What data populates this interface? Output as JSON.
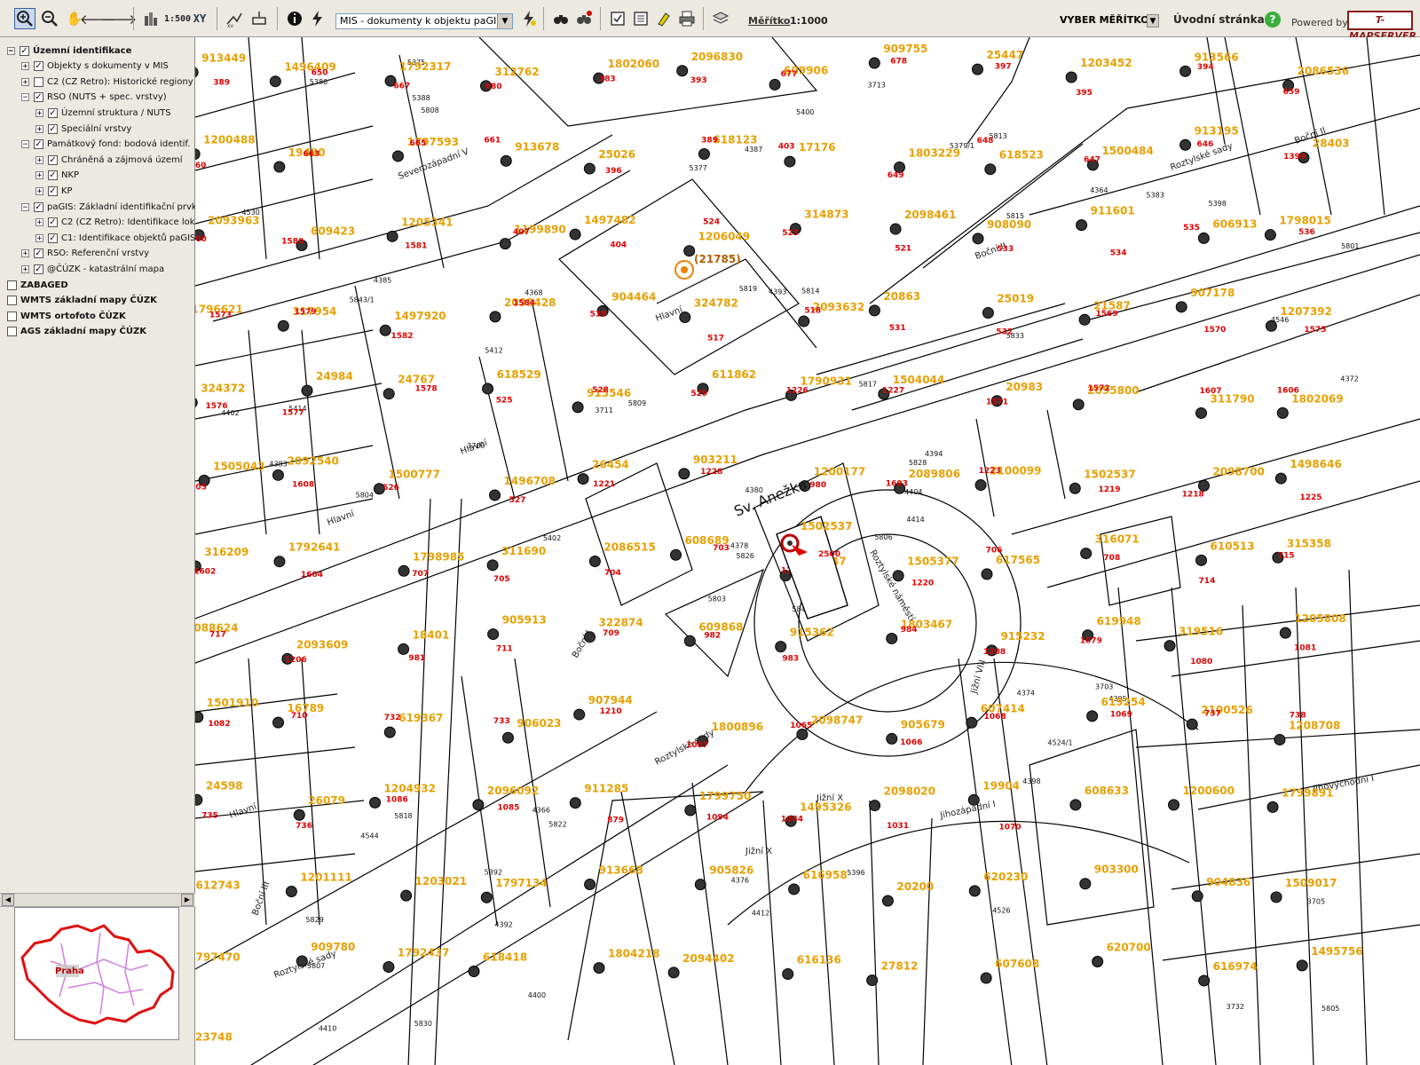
{
  "toolbar": {
    "zoom_scale_label": "1:500",
    "xy_label": "XY",
    "layer_select_value": "MIS - dokumenty k objektu paGIS",
    "scale_link_label": "Měřítko",
    "scale_value": "1:1000",
    "scale_select_value": "VYBER MĚŘÍTKO",
    "home_label": "Úvodní stránka",
    "help_label": "?",
    "powered_label": "Powered by",
    "logo_text": "T-MAPSERVER"
  },
  "layers": [
    {
      "label": "Územní identifikace",
      "checked": true,
      "bold": true,
      "level": 0,
      "expander": "−"
    },
    {
      "label": "Objekty s dokumenty v MIS",
      "checked": true,
      "bold": false,
      "level": 1,
      "expander": "+"
    },
    {
      "label": "C2 (CZ Retro): Historické regiony",
      "checked": false,
      "bold": false,
      "level": 1,
      "expander": "+"
    },
    {
      "label": "RSO (NUTS + spec. vrstvy)",
      "checked": true,
      "bold": false,
      "level": 1,
      "expander": "−"
    },
    {
      "label": "Územní struktura / NUTS",
      "checked": true,
      "bold": false,
      "level": 2,
      "expander": "+"
    },
    {
      "label": "Speciální vrstvy",
      "checked": true,
      "bold": false,
      "level": 2,
      "expander": "+"
    },
    {
      "label": "Památkový fond: bodová identif.",
      "checked": true,
      "bold": false,
      "level": 1,
      "expander": "−"
    },
    {
      "label": "Chráněná a zájmová území",
      "checked": true,
      "bold": false,
      "level": 2,
      "expander": "+"
    },
    {
      "label": "NKP",
      "checked": true,
      "bold": false,
      "level": 2,
      "expander": "+"
    },
    {
      "label": "KP",
      "checked": true,
      "bold": false,
      "level": 2,
      "expander": "+"
    },
    {
      "label": "paGIS: Základní identifikační prvky",
      "checked": true,
      "bold": false,
      "level": 1,
      "expander": "−"
    },
    {
      "label": "C2 (CZ Retro): Identifikace lokalit",
      "checked": true,
      "bold": false,
      "level": 2,
      "expander": "+"
    },
    {
      "label": "C1: Identifikace objektů paGIS",
      "checked": true,
      "bold": false,
      "level": 2,
      "expander": "+"
    },
    {
      "label": "RSO: Referenční vrstvy",
      "checked": true,
      "bold": false,
      "level": 1,
      "expander": "+"
    },
    {
      "label": "@ČÚZK - katastrální mapa",
      "checked": true,
      "bold": false,
      "level": 1,
      "expander": "+"
    },
    {
      "label": "ZABAGED",
      "checked": false,
      "bold": true,
      "level": 0,
      "expander": ""
    },
    {
      "label": "WMTS základní mapy ČÚZK",
      "checked": false,
      "bold": true,
      "level": 0,
      "expander": ""
    },
    {
      "label": "WMTS ortofoto ČÚZK",
      "checked": false,
      "bold": true,
      "level": 0,
      "expander": ""
    },
    {
      "label": "AGS základní mapy ČÚZK",
      "checked": false,
      "bold": true,
      "level": 0,
      "expander": ""
    }
  ],
  "overview": {
    "label": "Praha"
  },
  "map": {
    "church_label": "Sv. Anežka",
    "highlight_label": "(21785)",
    "selected_id": "1502537",
    "selected_red": "2500",
    "streets": [
      "Hlavní",
      "Boční I",
      "Boční II",
      "Roztylské sady",
      "Roztylské náměstí",
      "Jižní X",
      "Jižní VIII",
      "Jihovýchodní I",
      "Jihozápadní I",
      "Severozápadní V",
      "Boční III"
    ],
    "parcels": [
      "5843/2",
      "5843/1",
      "5826",
      "5829",
      "5828",
      "5822",
      "5813",
      "5814",
      "5815",
      "5806",
      "5808",
      "5805",
      "5804",
      "5801",
      "5803",
      "5833",
      "5830",
      "5819",
      "5817",
      "5818",
      "5809",
      "5807",
      "4392",
      "4393",
      "4394",
      "4395",
      "4385",
      "4387",
      "4383",
      "4374",
      "4372",
      "4378",
      "4376",
      "4380",
      "4368",
      "4364",
      "4366",
      "3732",
      "3705",
      "3703",
      "3713",
      "3711",
      "3709",
      "4398",
      "4400",
      "4402",
      "4404",
      "4410",
      "4412",
      "4414",
      "4544",
      "4546",
      "4530",
      "4524/1",
      "4526",
      "5392",
      "5388",
      "5386",
      "5396",
      "5398",
      "5400",
      "5402",
      "5414",
      "5412",
      "5383",
      "5375",
      "5379/1",
      "5377"
    ],
    "orange_labels": [
      "913449",
      "1496409",
      "1792317",
      "312762",
      "1802060",
      "2096830",
      "609906",
      "909755",
      "25447",
      "1203452",
      "913566",
      "2086536",
      "1200488",
      "19490",
      "1797593",
      "913678",
      "25026",
      "618123",
      "17176",
      "1803229",
      "618523",
      "1500484",
      "913195",
      "28403",
      "2093963",
      "609423",
      "1205341",
      "1199890",
      "1497482",
      "1206049",
      "314873",
      "2098461",
      "908090",
      "911601",
      "606913",
      "1798015",
      "1796621",
      "317954",
      "1497920",
      "2098428",
      "904464",
      "324782",
      "2093632",
      "20863",
      "25019",
      "21587",
      "907178",
      "1207392",
      "324372",
      "24984",
      "24767",
      "618529",
      "915546",
      "611862",
      "1790931",
      "1504044",
      "20983",
      "2095800",
      "311790",
      "1802069",
      "1505043",
      "2092540",
      "1500777",
      "1496708",
      "26454",
      "903211",
      "1200177",
      "2089806",
      "2100099",
      "1502537",
      "2098700",
      "1498646",
      "316209",
      "1792641",
      "1798985",
      "311690",
      "2086515",
      "608689",
      "2089747",
      "1505377",
      "617565",
      "316071",
      "610513",
      "315358",
      "2088624",
      "2093609",
      "18401",
      "905913",
      "322874",
      "609868",
      "915362",
      "1803467",
      "915232",
      "619948",
      "319516",
      "1205808",
      "1501910",
      "16789",
      "619367",
      "906023",
      "907944",
      "1800896",
      "2098747",
      "905679",
      "607414",
      "619254",
      "2100526",
      "1208708",
      "24598",
      "26079",
      "1204932",
      "2096092",
      "911285",
      "1799750",
      "1495326",
      "2098020",
      "19904",
      "608633",
      "1200600",
      "1799891",
      "612743",
      "1201111",
      "1203021",
      "1797134",
      "913668",
      "905826",
      "616958",
      "20200",
      "620230",
      "903300",
      "904836",
      "1509017",
      "1797470",
      "909780",
      "1792437",
      "618418",
      "1804218",
      "2094402",
      "616136",
      "27812",
      "607608",
      "620700",
      "616974",
      "1495756",
      "23748"
    ],
    "red_labels": [
      "389",
      "650",
      "667",
      "680",
      "383",
      "393",
      "677",
      "678",
      "397",
      "395",
      "394",
      "659",
      "660",
      "663",
      "665",
      "661",
      "396",
      "389",
      "403",
      "649",
      "648",
      "647",
      "646",
      "1399",
      "1400",
      "1580",
      "1581",
      "407",
      "404",
      "524",
      "523",
      "521",
      "533",
      "534",
      "535",
      "536",
      "1573",
      "1579",
      "1582",
      "1584",
      "519",
      "517",
      "518",
      "531",
      "532",
      "1569",
      "1570",
      "1575",
      "1576",
      "1577",
      "1578",
      "525",
      "528",
      "529",
      "1226",
      "1227",
      "1571",
      "1572",
      "1607",
      "1606",
      "1605",
      "1608",
      "526",
      "527",
      "1221",
      "1228",
      "980",
      "1603",
      "1223",
      "1219",
      "1218",
      "1225",
      "1602",
      "1604",
      "707",
      "705",
      "704",
      "703",
      "1207",
      "1220",
      "706",
      "708",
      "714",
      "715",
      "717",
      "1206",
      "981",
      "711",
      "709",
      "982",
      "983",
      "984",
      "1208",
      "1079",
      "1080",
      "1081",
      "1082",
      "710",
      "732",
      "733",
      "1210",
      "1087",
      "1065",
      "1066",
      "1068",
      "1069",
      "737",
      "738",
      "735",
      "736",
      "1086",
      "1085",
      "879",
      "1094",
      "1084",
      "1031",
      "1070"
    ]
  }
}
